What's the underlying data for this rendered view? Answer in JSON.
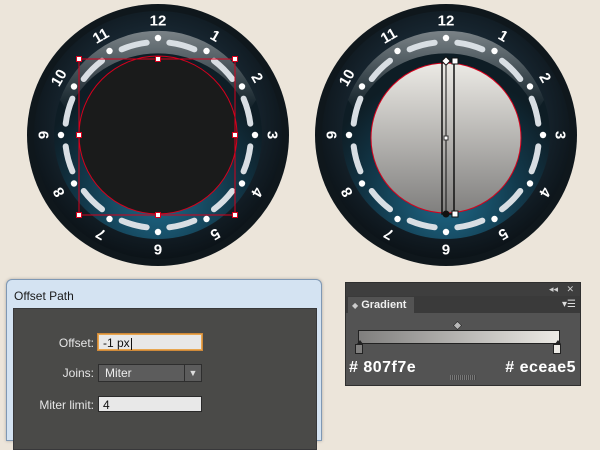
{
  "clock_left": {
    "numbers": [
      "1",
      "2",
      "3",
      "4",
      "5",
      "6",
      "7",
      "8",
      "9",
      "10",
      "11",
      "12"
    ]
  },
  "clock_right": {
    "numbers": [
      "1",
      "2",
      "3",
      "4",
      "5",
      "6",
      "7",
      "8",
      "9",
      "10",
      "11",
      "12"
    ]
  },
  "offset_dialog": {
    "title": "Offset Path",
    "offset_label": "Offset:",
    "offset_value": "-1 px",
    "joins_label": "Joins:",
    "joins_value": "Miter",
    "miter_label": "Miter limit:",
    "miter_value": "4"
  },
  "gradient_panel": {
    "tab_label": "Gradient",
    "collapse_icon": "collapse-arrows-icon",
    "close_icon": "close-icon",
    "menu_icon": "panel-menu-icon",
    "start_color": "#807f7e",
    "end_color": "#eceae5",
    "start_label": "# 807f7e",
    "end_label": "# eceae5"
  },
  "colors": {
    "background": "#ece5da",
    "bezel_dark": "#1f2d38",
    "dial_fill": "#1a1b1b",
    "selection_red": "#d6001c"
  }
}
